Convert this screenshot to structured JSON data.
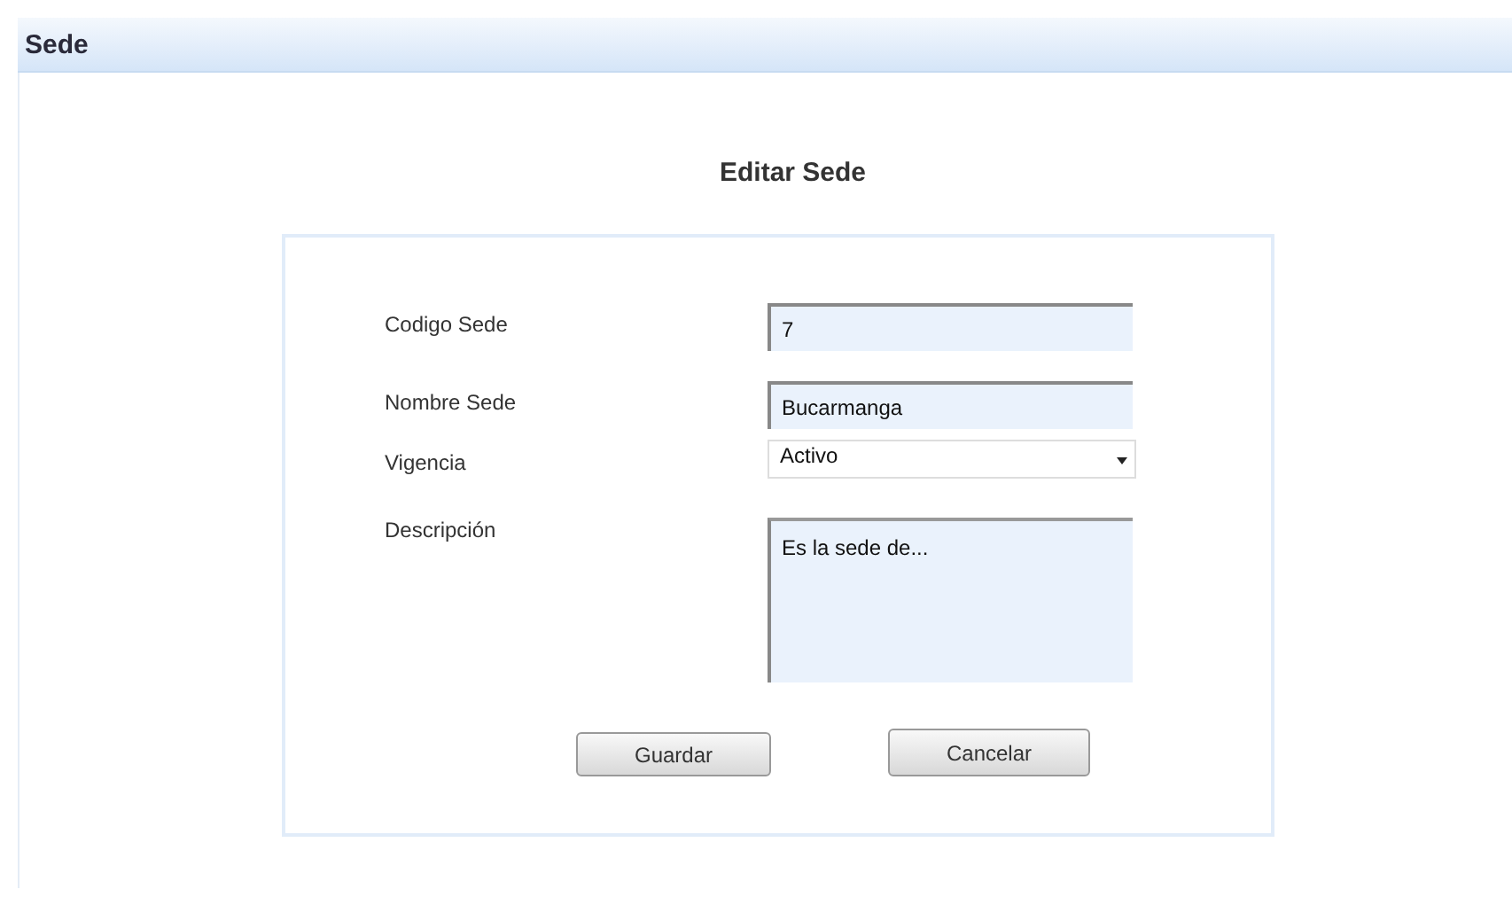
{
  "header": {
    "title": "Sede"
  },
  "form": {
    "title": "Editar Sede",
    "fields": [
      {
        "kind": "text",
        "label": "Codigo Sede",
        "value": "7"
      },
      {
        "kind": "text",
        "label": "Nombre Sede",
        "value": "Bucarmanga"
      },
      {
        "kind": "select",
        "label": "Vigencia",
        "value": "Activo"
      },
      {
        "kind": "textarea",
        "label": "Descripción",
        "value": "Es la sede de..."
      }
    ],
    "buttons": [
      "Guardar",
      "Cancelar"
    ]
  }
}
